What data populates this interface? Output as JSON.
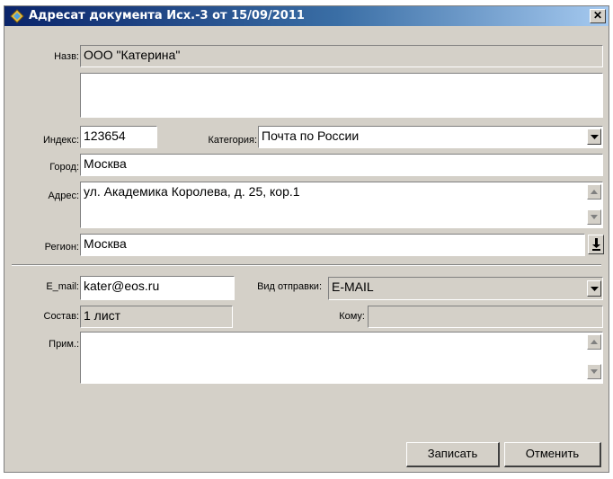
{
  "window": {
    "title": "Адресат документа Исх.-3 от 15/09/2011",
    "close_glyph": "✕"
  },
  "form": {
    "name": {
      "label": "Назв:",
      "value": "ООО \"Катерина\"",
      "extra": ""
    },
    "index": {
      "label": "Индекс:",
      "value": "123654"
    },
    "category": {
      "label": "Категория:",
      "value": "Почта по России"
    },
    "city": {
      "label": "Город:",
      "value": "Москва"
    },
    "address": {
      "label": "Адрес:",
      "value": "ул. Академика Королева, д. 25, кор.1"
    },
    "region": {
      "label": "Регион:",
      "value": "Москва"
    },
    "email": {
      "label": "E_mail:",
      "value": "kater@eos.ru"
    },
    "send_type": {
      "label": "Вид отправки:",
      "value": "E-MAIL"
    },
    "composition": {
      "label": "Состав:",
      "value": "1 лист"
    },
    "recipient": {
      "label": "Кому:",
      "value": ""
    },
    "note": {
      "label": "Прим.:",
      "value": ""
    }
  },
  "buttons": {
    "save": "Записать",
    "cancel": "Отменить"
  },
  "icons": {
    "title": "app-icon",
    "dropdown": "chevron-down-icon",
    "scroll_up": "scroll-up-arrow-icon",
    "scroll_down": "scroll-down-arrow-icon",
    "region_lookup": "download-arrow-icon"
  }
}
